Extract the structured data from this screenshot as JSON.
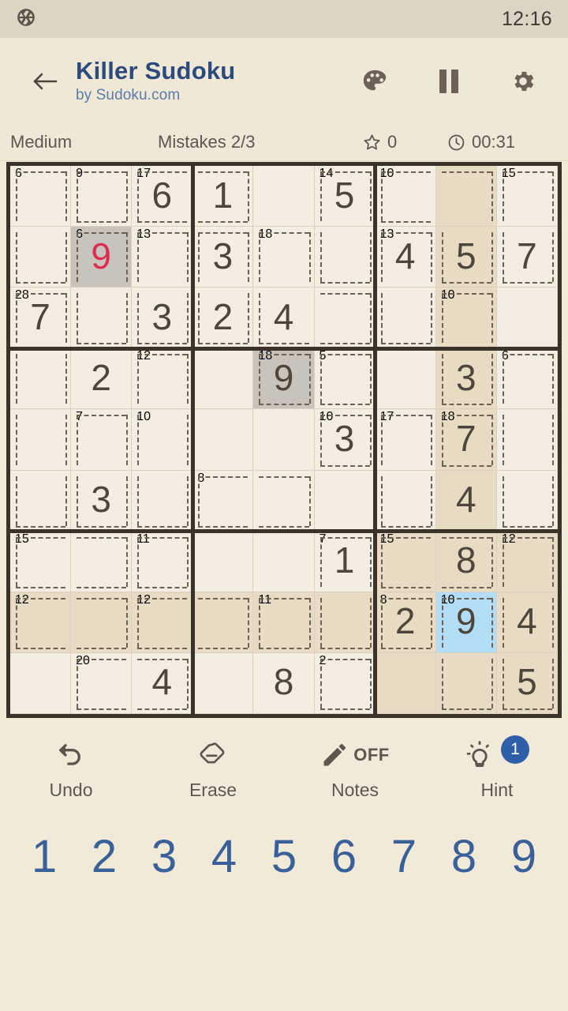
{
  "status_bar": {
    "clock": "12:16",
    "left_icon": "camera-aperture-icon"
  },
  "header": {
    "back_icon": "back-arrow-icon",
    "title": "Killer Sudoku",
    "subtitle": "by Sudoku.com",
    "icons": [
      "palette-icon",
      "pause-icon",
      "gear-icon"
    ]
  },
  "info_bar": {
    "difficulty": "Medium",
    "mistakes": "Mistakes 2/3",
    "score": "0",
    "score_icon": "star-icon",
    "timer": "00:31",
    "timer_icon": "clock-icon"
  },
  "tools": [
    {
      "name": "undo",
      "label": "Undo",
      "icon": "undo-arrow-icon"
    },
    {
      "name": "erase",
      "label": "Erase",
      "icon": "eraser-icon"
    },
    {
      "name": "notes",
      "label": "Notes",
      "icon": "pencil-icon",
      "state": "OFF"
    },
    {
      "name": "hint",
      "label": "Hint",
      "icon": "lightbulb-icon",
      "badge": "1"
    }
  ],
  "numpad": [
    "1",
    "2",
    "3",
    "4",
    "5",
    "6",
    "7",
    "8",
    "9"
  ],
  "colors": {
    "accent_blue": "#3a6098",
    "title_blue": "#2c4a7c",
    "error_red": "#dd2b51",
    "selected_cell": "#b3dcf7",
    "highlight_cell": "#e7dcc3",
    "grey_cell": "#c8c4bb",
    "board_bg": "#f4eee2",
    "page_bg": "#f2ead9",
    "grid_line": "#3b332a",
    "badge_blue": "#2f5fa8"
  },
  "board": {
    "rows": 9,
    "cols": 9,
    "selected": {
      "row": 8,
      "col": 8
    },
    "values": [
      [
        null,
        null,
        "6",
        "1",
        null,
        "5",
        null,
        null,
        null
      ],
      [
        null,
        "9",
        null,
        "3",
        null,
        null,
        "4",
        "5",
        "7"
      ],
      [
        "7",
        null,
        "3",
        "2",
        "4",
        null,
        null,
        null,
        null
      ],
      [
        null,
        "2",
        null,
        null,
        "9",
        null,
        null,
        "3",
        null
      ],
      [
        null,
        null,
        null,
        null,
        null,
        "3",
        null,
        "7",
        null
      ],
      [
        null,
        "3",
        null,
        null,
        null,
        null,
        null,
        "4",
        null
      ],
      [
        null,
        null,
        null,
        null,
        null,
        "1",
        null,
        "8",
        null
      ],
      [
        null,
        null,
        null,
        null,
        null,
        null,
        "2",
        "9",
        "4"
      ],
      [
        null,
        null,
        "4",
        null,
        "8",
        null,
        null,
        null,
        "5"
      ]
    ],
    "wrong_cells": [
      {
        "row": 2,
        "col": 2
      }
    ],
    "grey_cells": [
      {
        "row": 2,
        "col": 2
      },
      {
        "row": 4,
        "col": 5
      }
    ],
    "highlight_cells_note": "column 8 rows 1-9, row 8 cols 1-9, bottom-right box rows 7-9 cols 7-9",
    "highlighted_col": 8,
    "highlighted_row": 8,
    "highlighted_box": {
      "row_start": 7,
      "row_end": 9,
      "col_start": 7,
      "col_end": 9
    },
    "cages": [
      {
        "sum": "6",
        "cells": [
          [
            1,
            1
          ],
          [
            2,
            1
          ]
        ]
      },
      {
        "sum": "9",
        "cells": [
          [
            1,
            2
          ]
        ]
      },
      {
        "sum": "17",
        "cells": [
          [
            1,
            3
          ],
          [
            1,
            4
          ]
        ]
      },
      {
        "sum": "14",
        "cells": [
          [
            1,
            6
          ],
          [
            2,
            6
          ]
        ]
      },
      {
        "sum": "10",
        "cells": [
          [
            1,
            7
          ],
          [
            1,
            8
          ],
          [
            2,
            8
          ]
        ]
      },
      {
        "sum": "15",
        "cells": [
          [
            1,
            9
          ],
          [
            2,
            9
          ]
        ]
      },
      {
        "sum": "6",
        "cells": [
          [
            2,
            2
          ],
          [
            3,
            2
          ]
        ]
      },
      {
        "sum": "13",
        "cells": [
          [
            2,
            3
          ],
          [
            3,
            3
          ]
        ]
      },
      {
        "sum": "18",
        "cells": [
          [
            2,
            5
          ],
          [
            3,
            5
          ],
          [
            3,
            6
          ]
        ]
      },
      {
        "sum": "13",
        "cells": [
          [
            2,
            7
          ],
          [
            3,
            7
          ]
        ]
      },
      {
        "sum": "28",
        "cells": [
          [
            3,
            1
          ],
          [
            4,
            1
          ],
          [
            5,
            1
          ],
          [
            6,
            1
          ]
        ]
      },
      {
        "sum": "18b",
        "cells": [
          [
            2,
            4
          ],
          [
            3,
            4
          ]
        ]
      },
      {
        "sum": "10",
        "cells": [
          [
            3,
            8
          ],
          [
            4,
            8
          ]
        ]
      },
      {
        "sum": "12",
        "cells": [
          [
            4,
            3
          ],
          [
            5,
            3
          ],
          [
            6,
            3
          ]
        ]
      },
      {
        "sum": "18",
        "cells": [
          [
            4,
            5
          ]
        ]
      },
      {
        "sum": "5",
        "cells": [
          [
            4,
            6
          ]
        ]
      },
      {
        "sum": "6",
        "cells": [
          [
            4,
            9
          ],
          [
            5,
            9
          ],
          [
            6,
            9
          ]
        ]
      },
      {
        "sum": "7",
        "cells": [
          [
            5,
            2
          ],
          [
            6,
            2
          ]
        ]
      },
      {
        "sum": "10",
        "cells": [
          [
            5,
            6
          ]
        ]
      },
      {
        "sum": "17",
        "cells": [
          [
            5,
            7
          ],
          [
            6,
            7
          ]
        ]
      },
      {
        "sum": "18",
        "cells": [
          [
            5,
            8
          ]
        ]
      },
      {
        "sum": "8",
        "cells": [
          [
            6,
            4
          ],
          [
            6,
            5
          ]
        ]
      },
      {
        "sum": "15",
        "cells": [
          [
            7,
            1
          ],
          [
            7,
            2
          ]
        ]
      },
      {
        "sum": "11",
        "cells": [
          [
            7,
            3
          ]
        ]
      },
      {
        "sum": "7",
        "cells": [
          [
            7,
            6
          ],
          [
            8,
            6
          ]
        ]
      },
      {
        "sum": "15",
        "cells": [
          [
            7,
            7
          ],
          [
            7,
            8
          ]
        ]
      },
      {
        "sum": "12",
        "cells": [
          [
            7,
            9
          ],
          [
            8,
            9
          ],
          [
            9,
            9
          ]
        ]
      },
      {
        "sum": "12",
        "cells": [
          [
            8,
            1
          ],
          [
            8,
            2
          ]
        ]
      },
      {
        "sum": "12",
        "cells": [
          [
            8,
            3
          ],
          [
            8,
            4
          ]
        ]
      },
      {
        "sum": "11",
        "cells": [
          [
            8,
            5
          ]
        ]
      },
      {
        "sum": "8",
        "cells": [
          [
            8,
            7
          ]
        ]
      },
      {
        "sum": "10",
        "cells": [
          [
            8,
            8
          ],
          [
            9,
            8
          ]
        ]
      },
      {
        "sum": "20",
        "cells": [
          [
            9,
            2
          ],
          [
            9,
            3
          ]
        ]
      },
      {
        "sum": "2",
        "cells": [
          [
            9,
            6
          ]
        ]
      }
    ],
    "cage_labels": [
      {
        "row": 1,
        "col": 1,
        "sum": "6"
      },
      {
        "row": 1,
        "col": 2,
        "sum": "9"
      },
      {
        "row": 1,
        "col": 3,
        "sum": "17"
      },
      {
        "row": 1,
        "col": 6,
        "sum": "14"
      },
      {
        "row": 1,
        "col": 7,
        "sum": "10"
      },
      {
        "row": 1,
        "col": 9,
        "sum": "15"
      },
      {
        "row": 2,
        "col": 2,
        "sum": "6"
      },
      {
        "row": 2,
        "col": 3,
        "sum": "13"
      },
      {
        "row": 2,
        "col": 5,
        "sum": "18"
      },
      {
        "row": 2,
        "col": 7,
        "sum": "13"
      },
      {
        "row": 3,
        "col": 1,
        "sum": "28"
      },
      {
        "row": 3,
        "col": 8,
        "sum": "10"
      },
      {
        "row": 4,
        "col": 3,
        "sum": "12"
      },
      {
        "row": 4,
        "col": 5,
        "sum": "18"
      },
      {
        "row": 4,
        "col": 6,
        "sum": "5"
      },
      {
        "row": 4,
        "col": 9,
        "sum": "6"
      },
      {
        "row": 5,
        "col": 2,
        "sum": "7"
      },
      {
        "row": 5,
        "col": 3,
        "sum": "10"
      },
      {
        "row": 5,
        "col": 6,
        "sum": "10"
      },
      {
        "row": 5,
        "col": 7,
        "sum": "17"
      },
      {
        "row": 5,
        "col": 8,
        "sum": "18"
      },
      {
        "row": 6,
        "col": 4,
        "sum": "8"
      },
      {
        "row": 7,
        "col": 1,
        "sum": "15"
      },
      {
        "row": 7,
        "col": 3,
        "sum": "11"
      },
      {
        "row": 7,
        "col": 6,
        "sum": "7"
      },
      {
        "row": 7,
        "col": 7,
        "sum": "15"
      },
      {
        "row": 7,
        "col": 9,
        "sum": "12"
      },
      {
        "row": 8,
        "col": 1,
        "sum": "12"
      },
      {
        "row": 8,
        "col": 3,
        "sum": "12"
      },
      {
        "row": 8,
        "col": 5,
        "sum": "11"
      },
      {
        "row": 8,
        "col": 7,
        "sum": "8"
      },
      {
        "row": 8,
        "col": 8,
        "sum": "10"
      },
      {
        "row": 9,
        "col": 2,
        "sum": "20"
      },
      {
        "row": 9,
        "col": 6,
        "sum": "2"
      }
    ]
  }
}
